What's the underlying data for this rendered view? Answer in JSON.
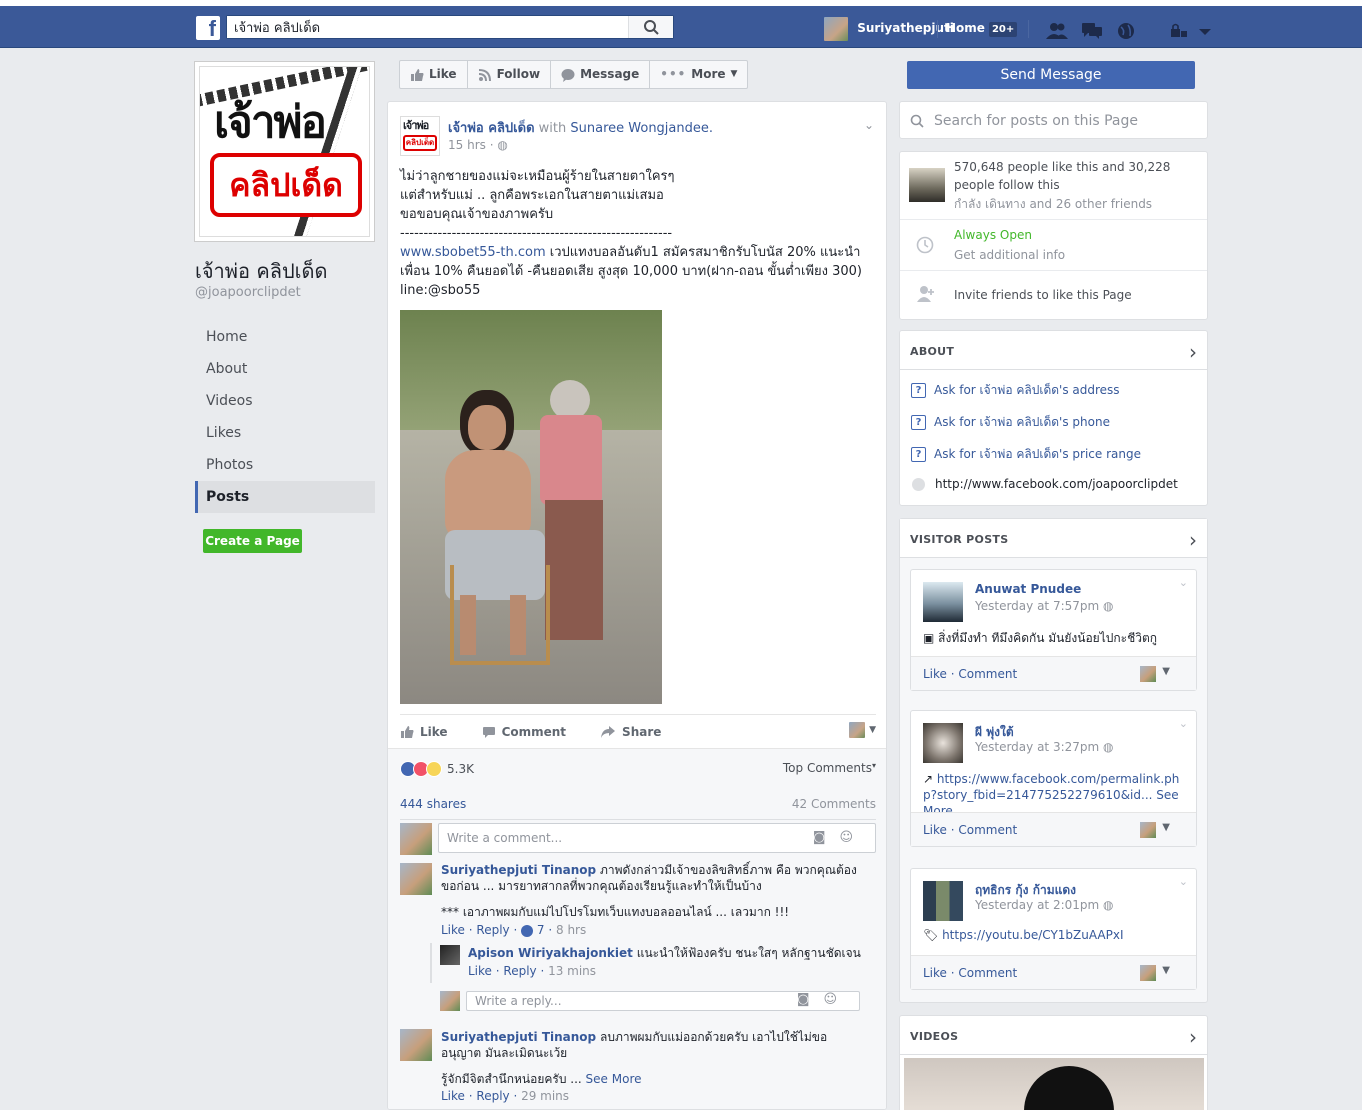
{
  "topbar": {
    "logo": "f",
    "search_value": "เจ้าพ่อ คลิปเด็ด",
    "user_name": "Suriyathepjuti",
    "home_label": "Home",
    "home_count": "20+"
  },
  "page": {
    "logo_top": "เจ้าพ่อ",
    "logo_bottom": "คลิปเด็ด",
    "name": "เจ้าพ่อ คลิปเด็ด",
    "handle": "@joapoorclipdet"
  },
  "nav": {
    "items": [
      "Home",
      "About",
      "Videos",
      "Likes",
      "Photos",
      "Posts"
    ],
    "create_page": "Create a Page"
  },
  "actions": {
    "like": "Like",
    "follow": "Follow",
    "message": "Message",
    "more": "More",
    "send_message": "Send Message"
  },
  "post": {
    "avatar_top": "เจ้าพ่อ",
    "avatar_bottom": "คลิปเด็ด",
    "author": "เจ้าพ่อ คลิปเด็ด",
    "with_label": "with",
    "tagged": "Sunaree Wongjandee.",
    "time": "15 hrs",
    "line1": "ไม่ว่าลูกชายของแม่จะเหมือนผู้ร้ายในสายตาใครๆ",
    "line2": "แต่สำหรับแม่ .. ลูกคือพระเอกในสายตาแม่เสมอ",
    "line3": "ขอขอบคุณเจ้าของภาพครับ",
    "line4": "----------------------------------------------------------",
    "link": "www.sbobet55-th.com",
    "promo": "เวปแทงบอลอันดับ1 สมัครสมาชิกรับโบนัส 20% แนะนำเพื่อน 10% คืนยอดได้ -คืนยอดเสีย สูงสุด 10,000 บาท(ฝาก-ถอน ขั้นต่ำเพียง 300) line:@sbo55",
    "btn_like": "Like",
    "btn_comment": "Comment",
    "btn_share": "Share",
    "reactions": "5.3K",
    "top_comments": "Top Comments",
    "shares": "444 shares",
    "comments": "42 Comments",
    "write_comment": "Write a comment...",
    "write_reply": "Write a reply..."
  },
  "comments": [
    {
      "name": "Suriyathepjuti Tinanop",
      "text": "ภาพดังกล่าวมีเจ้าของลิขสิทธิ์ภาพ คือ พวกคุณต้องขอก่อน ... มารยาทสากลที่พวกคุณต้องเรียนรู้และทำให้เป็นบ้าง",
      "text2": "*** เอาภาพผมกับแม่ไปโปรโมทเว็บแทงบอลออนไลน์ ... เลวมาก !!!",
      "like": "Like",
      "reply": "Reply",
      "likes": "7",
      "time": "8 hrs"
    },
    {
      "name": "Apison Wiriyakhajonkiet",
      "text": "แนะนำให้ฟ้องครับ ชนะใสๆ หลักฐานชัดเจน",
      "like": "Like",
      "reply": "Reply",
      "time": "13 mins"
    },
    {
      "name": "Suriyathepjuti Tinanop",
      "text": "ลบภาพผมกับแม่ออกด้วยครับ เอาไปใช้ไม่ขออนุญาต มันละเมิดนะเว้ย",
      "text2": "รู้จักมีจิตสำนึกหน่อยครับ ...",
      "see_more": "See More",
      "like": "Like",
      "reply": "Reply",
      "time": "29 mins"
    }
  ],
  "right": {
    "search_placeholder": "Search for posts on this Page",
    "likes_text": "570,648 people like this and 30,228 people follow this",
    "friends_text": "กำลัง เดินทาง and 26 other friends",
    "always_open": "Always Open",
    "additional_info": "Get additional info",
    "invite": "Invite friends to like this Page",
    "about_title": "ABOUT",
    "ask_address": "Ask for เจ้าพ่อ คลิปเด็ด's address",
    "ask_phone": "Ask for เจ้าพ่อ คลิปเด็ด's phone",
    "ask_price": "Ask for เจ้าพ่อ คลิปเด็ด's price range",
    "url": "http://www.facebook.com/joapoorclipdet",
    "visitor_title": "VISITOR POSTS",
    "videos_title": "VIDEOS"
  },
  "visitor_posts": [
    {
      "name": "Anuwat Pnudee",
      "time": "Yesterday at 7:57pm",
      "body": "สิ่งที่มึงทำ ทีมึงคิดกัน มันยังน้อยไปกะชีวิตกู",
      "foot": "Like · Comment"
    },
    {
      "name": "ผี พุ่งใต้",
      "time": "Yesterday at 3:27pm",
      "body": "https://www.facebook.com/permalink.php?story_fbid=214775252279610&id...",
      "see_more": "See More",
      "foot": "Like · Comment"
    },
    {
      "name": "ฤทธิกร กุ้ง ก้ามแดง",
      "time": "Yesterday at 2:01pm",
      "body": "https://youtu.be/CY1bZuAAPxI",
      "foot": "Like · Comment"
    }
  ],
  "colors": {
    "topbar": "#3b5998",
    "link": "#365899",
    "send_button": "#4267b2",
    "create_button": "#42b72a"
  }
}
